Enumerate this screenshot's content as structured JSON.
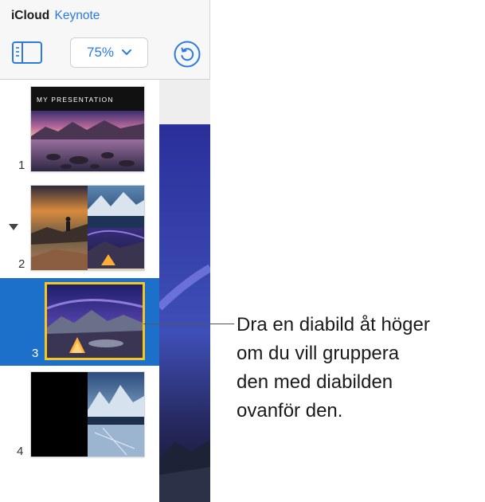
{
  "header": {
    "brand_icloud": "iCloud",
    "brand_app": "Keynote",
    "zoom_value": "75%"
  },
  "icons": {
    "sidebar_toggle": "sidebar-toggle-icon",
    "zoom_dropdown": "chevron-down-icon",
    "undo": "undo-arrow-icon",
    "collapse_group": "triangle-down-icon"
  },
  "colors": {
    "accent": "#2a7ae2",
    "selection_bg": "#1d70c9",
    "selection_border": "#f3c623"
  },
  "slides": [
    {
      "number": "1",
      "title": "MY PRESENTATION"
    },
    {
      "number": "2"
    },
    {
      "number": "3",
      "selected": true
    },
    {
      "number": "4"
    }
  ],
  "callout": {
    "lines": [
      "Dra en diabild åt höger",
      "om du vill gruppera",
      "den med diabilden",
      "ovanför den."
    ]
  }
}
